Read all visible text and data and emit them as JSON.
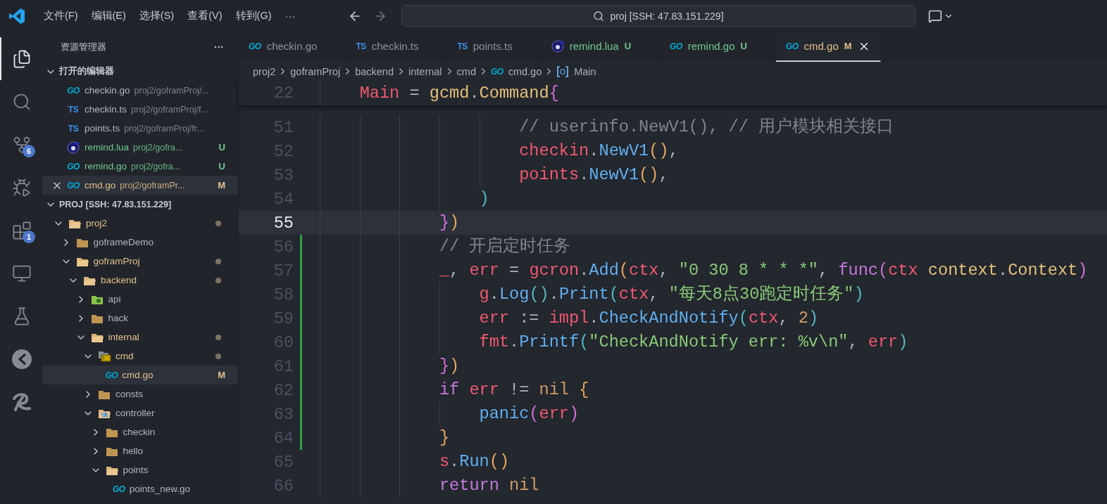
{
  "menu": [
    "文件(F)",
    "编辑(E)",
    "选择(S)",
    "查看(V)",
    "转到(G)",
    "···"
  ],
  "command_center": {
    "value": "proj [SSH: 47.83.151.229]"
  },
  "navigation": {
    "back_disabled": false,
    "forward_disabled": true
  },
  "activity_bar": [
    {
      "kind": "explorer",
      "selected": true
    },
    {
      "kind": "search",
      "selected": false
    },
    {
      "kind": "source-control",
      "selected": false,
      "badge": "6"
    },
    {
      "kind": "run-debug",
      "selected": false
    },
    {
      "kind": "extensions",
      "selected": false,
      "badge": "1"
    },
    {
      "kind": "remote",
      "selected": false
    },
    {
      "kind": "testing",
      "selected": false
    },
    {
      "kind": "disc",
      "selected": false
    },
    {
      "kind": "swirl",
      "selected": false
    }
  ],
  "sidebar": {
    "title": "资源管理器",
    "more": "···",
    "open_editors": {
      "title": "打开的编辑器",
      "expanded": true,
      "items": [
        {
          "name": "checkin.go",
          "path": "proj2/goframProj/...",
          "kind": "go",
          "icon_label": "GO",
          "selected": false
        },
        {
          "name": "checkin.ts",
          "path": "proj2/goframProj/f...",
          "kind": "ts",
          "icon_label": "TS",
          "selected": false
        },
        {
          "name": "points.ts",
          "path": "proj2/goframProj/fr...",
          "kind": "ts",
          "icon_label": "TS",
          "selected": false
        },
        {
          "name": "remind.lua",
          "path": "proj2/gofra...",
          "kind": "lua",
          "status": "U",
          "selected": false
        },
        {
          "name": "remind.go",
          "path": "proj2/gofra...",
          "kind": "go",
          "icon_label": "GO",
          "status": "U",
          "selected": false
        },
        {
          "name": "cmd.go",
          "path": "proj2/goframPr...",
          "kind": "go",
          "icon_label": "GO",
          "status": "M",
          "selected": true
        }
      ]
    },
    "folder": {
      "title": "PROJ [SSH: 47.83.151.229]",
      "expanded": true,
      "tree": [
        {
          "name": "proj2",
          "kind": "folder",
          "expanded": true,
          "modified": true,
          "selected": false,
          "children": [
            {
              "name": "goframeDemo",
              "kind": "folder",
              "expanded": false,
              "modified": false,
              "selected": false
            },
            {
              "name": "goframProj",
              "kind": "folder",
              "expanded": true,
              "modified": true,
              "selected": false,
              "children": [
                {
                  "name": "backend",
                  "kind": "folder",
                  "expanded": true,
                  "modified": true,
                  "selected": false,
                  "children": [
                    {
                      "name": "api",
                      "kind": "api-folder",
                      "expanded": false,
                      "modified": false,
                      "selected": false
                    },
                    {
                      "name": "hack",
                      "kind": "folder",
                      "expanded": false,
                      "modified": false,
                      "selected": false
                    },
                    {
                      "name": "internal",
                      "kind": "folder",
                      "expanded": true,
                      "modified": true,
                      "selected": false,
                      "children": [
                        {
                          "name": "cmd",
                          "kind": "cmd-folder",
                          "expanded": true,
                          "modified": true,
                          "selected": false,
                          "children": [
                            {
                              "name": "cmd.go",
                              "kind": "go-file",
                              "icon_label": "GO",
                              "status": "M",
                              "modified": true,
                              "selected": true
                            }
                          ]
                        },
                        {
                          "name": "consts",
                          "kind": "folder",
                          "expanded": false,
                          "modified": false,
                          "selected": false
                        },
                        {
                          "name": "controller",
                          "kind": "controller-folder",
                          "expanded": true,
                          "modified": false,
                          "selected": false,
                          "children": [
                            {
                              "name": "checkin",
                              "kind": "folder",
                              "expanded": false,
                              "modified": false,
                              "selected": false
                            },
                            {
                              "name": "hello",
                              "kind": "folder",
                              "expanded": false,
                              "modified": false,
                              "selected": false
                            },
                            {
                              "name": "points",
                              "kind": "folder",
                              "expanded": true,
                              "modified": false,
                              "selected": false,
                              "children": [
                                {
                                  "name": "points_new.go",
                                  "kind": "go-file",
                                  "icon_label": "GO",
                                  "modified": false,
                                  "selected": false
                                }
                              ]
                            }
                          ]
                        }
                      ]
                    }
                  ]
                }
              ]
            }
          ]
        }
      ]
    }
  },
  "tabs": [
    {
      "name": "checkin.go",
      "kind": "go",
      "icon_label": "GO",
      "selected": false
    },
    {
      "name": "checkin.ts",
      "kind": "ts",
      "icon_label": "TS",
      "selected": false
    },
    {
      "name": "points.ts",
      "kind": "ts",
      "icon_label": "TS",
      "selected": false
    },
    {
      "name": "remind.lua",
      "kind": "lua",
      "status": "U",
      "selected": false
    },
    {
      "name": "remind.go",
      "kind": "go",
      "icon_label": "GO",
      "status": "U",
      "selected": false
    },
    {
      "name": "cmd.go",
      "kind": "go",
      "icon_label": "GO",
      "status": "M",
      "selected": true
    }
  ],
  "breadcrumbs": [
    {
      "label": "proj2",
      "kind": "folder"
    },
    {
      "label": "goframProj",
      "kind": "folder"
    },
    {
      "label": "backend",
      "kind": "folder"
    },
    {
      "label": "internal",
      "kind": "folder"
    },
    {
      "label": "cmd",
      "kind": "folder"
    },
    {
      "label": "cmd.go",
      "kind": "go",
      "icon_label": "GO"
    },
    {
      "label": "Main",
      "kind": "symbol"
    }
  ],
  "sticky_line": {
    "number": "22",
    "tokens": [
      {
        "text": "\tMain",
        "kind": "var"
      },
      {
        "text": " = ",
        "kind": "op"
      },
      {
        "text": "gcmd",
        "kind": "type"
      },
      {
        "text": ".",
        "kind": "op"
      },
      {
        "text": "Command",
        "kind": "type"
      },
      {
        "text": "{",
        "kind": "bracket2"
      }
    ]
  },
  "lines": [
    {
      "number": "51",
      "current": false,
      "added": false,
      "tokens": [
        {
          "text": "\t\t\t\t\t// userinfo.NewV1(), // 用户模块相关接口",
          "kind": "comment"
        }
      ]
    },
    {
      "number": "52",
      "current": false,
      "added": false,
      "tokens": [
        {
          "text": "\t\t\t\t\tcheckin",
          "kind": "var"
        },
        {
          "text": ".",
          "kind": "op"
        },
        {
          "text": "NewV1",
          "kind": "func"
        },
        {
          "text": "()",
          "kind": "bracket1"
        },
        {
          "text": ",",
          "kind": "op"
        }
      ]
    },
    {
      "number": "53",
      "current": false,
      "added": false,
      "tokens": [
        {
          "text": "\t\t\t\t\tpoints",
          "kind": "var"
        },
        {
          "text": ".",
          "kind": "op"
        },
        {
          "text": "NewV1",
          "kind": "func"
        },
        {
          "text": "()",
          "kind": "bracket1"
        },
        {
          "text": ",",
          "kind": "op"
        }
      ]
    },
    {
      "number": "54",
      "current": false,
      "added": false,
      "tokens": [
        {
          "text": "\t\t\t\t)",
          "kind": "bracket3"
        }
      ]
    },
    {
      "number": "55",
      "current": true,
      "added": false,
      "tokens": [
        {
          "text": "\t\t\t}",
          "kind": "bracket2"
        },
        {
          "text": ")",
          "kind": "bracket1"
        }
      ]
    },
    {
      "number": "56",
      "current": false,
      "added": true,
      "tokens": [
        {
          "text": "\t\t\t// 开启定时任务",
          "kind": "comment"
        }
      ]
    },
    {
      "number": "57",
      "current": false,
      "added": true,
      "tokens": [
        {
          "text": "\t\t\t_",
          "kind": "var"
        },
        {
          "text": ", ",
          "kind": "op"
        },
        {
          "text": "err",
          "kind": "var"
        },
        {
          "text": " = ",
          "kind": "op"
        },
        {
          "text": "gcron",
          "kind": "var"
        },
        {
          "text": ".",
          "kind": "op"
        },
        {
          "text": "Add",
          "kind": "func"
        },
        {
          "text": "(",
          "kind": "bracket1"
        },
        {
          "text": "ctx",
          "kind": "var"
        },
        {
          "text": ", ",
          "kind": "op"
        },
        {
          "text": "\"0 30 8 * * *\"",
          "kind": "string"
        },
        {
          "text": ", ",
          "kind": "op"
        },
        {
          "text": "func",
          "kind": "keyword"
        },
        {
          "text": "(",
          "kind": "bracket2"
        },
        {
          "text": "ctx ",
          "kind": "var"
        },
        {
          "text": "context",
          "kind": "type"
        },
        {
          "text": ".",
          "kind": "op"
        },
        {
          "text": "Context",
          "kind": "type"
        },
        {
          "text": ")",
          "kind": "bracket2"
        }
      ]
    },
    {
      "number": "58",
      "current": false,
      "added": true,
      "tokens": [
        {
          "text": "\t\t\t\tg",
          "kind": "var"
        },
        {
          "text": ".",
          "kind": "op"
        },
        {
          "text": "Log",
          "kind": "func"
        },
        {
          "text": "()",
          "kind": "bracket3"
        },
        {
          "text": ".",
          "kind": "op"
        },
        {
          "text": "Print",
          "kind": "func"
        },
        {
          "text": "(",
          "kind": "bracket3"
        },
        {
          "text": "ctx",
          "kind": "var"
        },
        {
          "text": ", ",
          "kind": "op"
        },
        {
          "text": "\"每天8点30跑定时任务\"",
          "kind": "string"
        },
        {
          "text": ")",
          "kind": "bracket3"
        }
      ]
    },
    {
      "number": "59",
      "current": false,
      "added": true,
      "tokens": [
        {
          "text": "\t\t\t\terr",
          "kind": "var"
        },
        {
          "text": " := ",
          "kind": "op"
        },
        {
          "text": "impl",
          "kind": "var"
        },
        {
          "text": ".",
          "kind": "op"
        },
        {
          "text": "CheckAndNotify",
          "kind": "func"
        },
        {
          "text": "(",
          "kind": "bracket3"
        },
        {
          "text": "ctx",
          "kind": "var"
        },
        {
          "text": ", ",
          "kind": "op"
        },
        {
          "text": "2",
          "kind": "number"
        },
        {
          "text": ")",
          "kind": "bracket3"
        }
      ]
    },
    {
      "number": "60",
      "current": false,
      "added": true,
      "tokens": [
        {
          "text": "\t\t\t\tfmt",
          "kind": "var"
        },
        {
          "text": ".",
          "kind": "op"
        },
        {
          "text": "Printf",
          "kind": "func"
        },
        {
          "text": "(",
          "kind": "bracket3"
        },
        {
          "text": "\"CheckAndNotify err: %v\\n\"",
          "kind": "string"
        },
        {
          "text": ", ",
          "kind": "op"
        },
        {
          "text": "err",
          "kind": "var"
        },
        {
          "text": ")",
          "kind": "bracket3"
        }
      ]
    },
    {
      "number": "61",
      "current": false,
      "added": true,
      "tokens": [
        {
          "text": "\t\t\t}",
          "kind": "bracket2"
        },
        {
          "text": ")",
          "kind": "bracket1"
        }
      ]
    },
    {
      "number": "62",
      "current": false,
      "added": true,
      "tokens": [
        {
          "text": "\t\t\tif ",
          "kind": "keyword"
        },
        {
          "text": "err",
          "kind": "var"
        },
        {
          "text": " != ",
          "kind": "op"
        },
        {
          "text": "nil ",
          "kind": "number"
        },
        {
          "text": "{",
          "kind": "bracket1"
        }
      ]
    },
    {
      "number": "63",
      "current": false,
      "added": true,
      "tokens": [
        {
          "text": "\t\t\t\tpanic",
          "kind": "func"
        },
        {
          "text": "(",
          "kind": "bracket2"
        },
        {
          "text": "err",
          "kind": "var"
        },
        {
          "text": ")",
          "kind": "bracket2"
        }
      ]
    },
    {
      "number": "64",
      "current": false,
      "added": true,
      "tokens": [
        {
          "text": "\t\t\t}",
          "kind": "bracket1"
        }
      ]
    },
    {
      "number": "65",
      "current": false,
      "added": false,
      "tokens": [
        {
          "text": "\t\t\ts",
          "kind": "var"
        },
        {
          "text": ".",
          "kind": "op"
        },
        {
          "text": "Run",
          "kind": "func"
        },
        {
          "text": "()",
          "kind": "bracket1"
        }
      ]
    },
    {
      "number": "66",
      "current": false,
      "added": false,
      "tokens": [
        {
          "text": "\t\t\treturn ",
          "kind": "keyword"
        },
        {
          "text": "nil",
          "kind": "number"
        }
      ]
    }
  ]
}
